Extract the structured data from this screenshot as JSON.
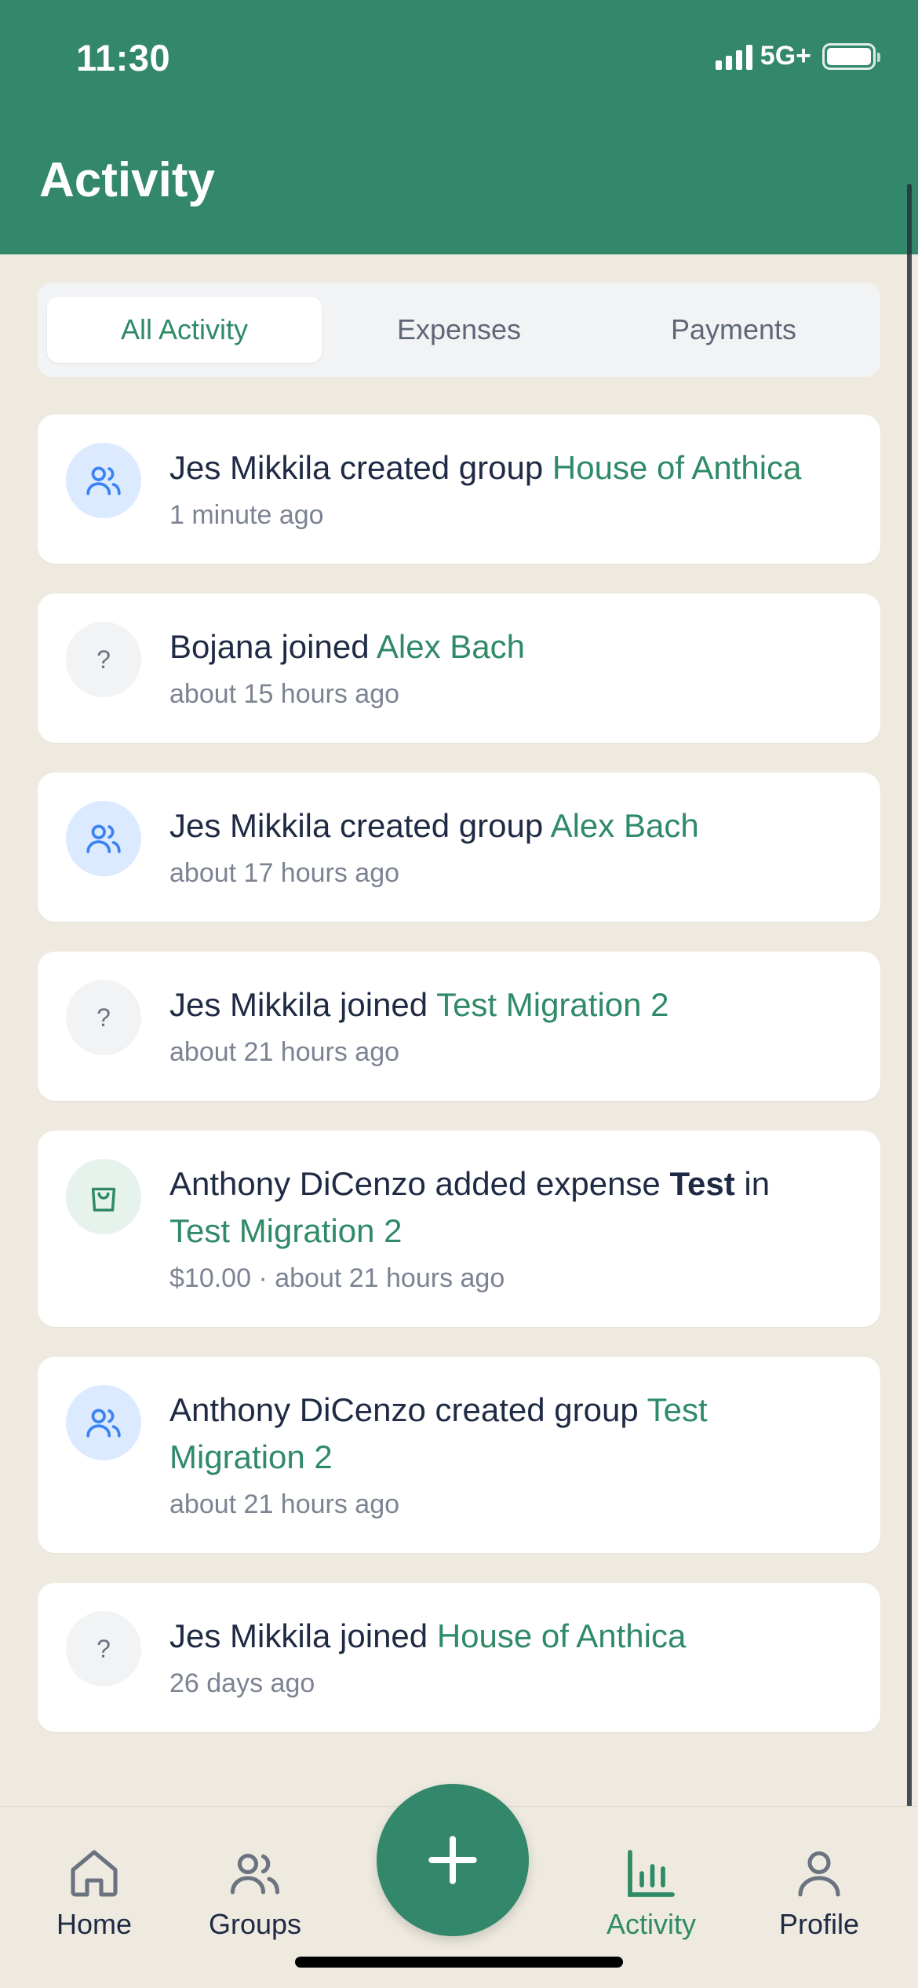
{
  "status_bar": {
    "time": "11:30",
    "network": "5G+"
  },
  "header": {
    "title": "Activity"
  },
  "tabs": [
    {
      "label": "All Activity",
      "active": true
    },
    {
      "label": "Expenses",
      "active": false
    },
    {
      "label": "Payments",
      "active": false
    }
  ],
  "activities": [
    {
      "type": "group-created",
      "actor": "Jes Mikkila",
      "verb": " created group ",
      "target": "House of Anthica",
      "time": "1 minute ago"
    },
    {
      "type": "joined",
      "actor": "Bojana",
      "verb": " joined ",
      "target": "Alex Bach",
      "time": "about 15 hours ago"
    },
    {
      "type": "group-created",
      "actor": "Jes Mikkila",
      "verb": " created group ",
      "target": "Alex Bach",
      "time": "about 17 hours ago"
    },
    {
      "type": "joined",
      "actor": "Jes Mikkila",
      "verb": " joined ",
      "target": "Test Migration 2",
      "time": "about 21 hours ago"
    },
    {
      "type": "expense-added",
      "actor": "Anthony DiCenzo",
      "verb": " added expense ",
      "expense": "Test",
      "preposition": " in",
      "target": "Test Migration 2",
      "amount": "$10.00",
      "separator": " · ",
      "time": "about 21 hours ago"
    },
    {
      "type": "group-created",
      "actor": "Anthony DiCenzo",
      "verb": " created group ",
      "target": "Test Migration 2",
      "time": "about 21 hours ago"
    },
    {
      "type": "joined",
      "actor": "Jes Mikkila",
      "verb": " joined ",
      "target": "House of Anthica",
      "time": "26 days ago"
    }
  ],
  "unknown_avatar_glyph": "?",
  "bottom_nav": [
    {
      "label": "Home",
      "icon": "home-icon",
      "active": false
    },
    {
      "label": "Groups",
      "icon": "users-icon",
      "active": false
    },
    {
      "label": "Activity",
      "icon": "bar-chart-icon",
      "active": true
    },
    {
      "label": "Profile",
      "icon": "user-icon",
      "active": false
    }
  ],
  "colors": {
    "brand": "#33876A",
    "accent_text": "#2F8A67",
    "background": "#EEEAE0",
    "group_icon": "#3B82F6"
  }
}
